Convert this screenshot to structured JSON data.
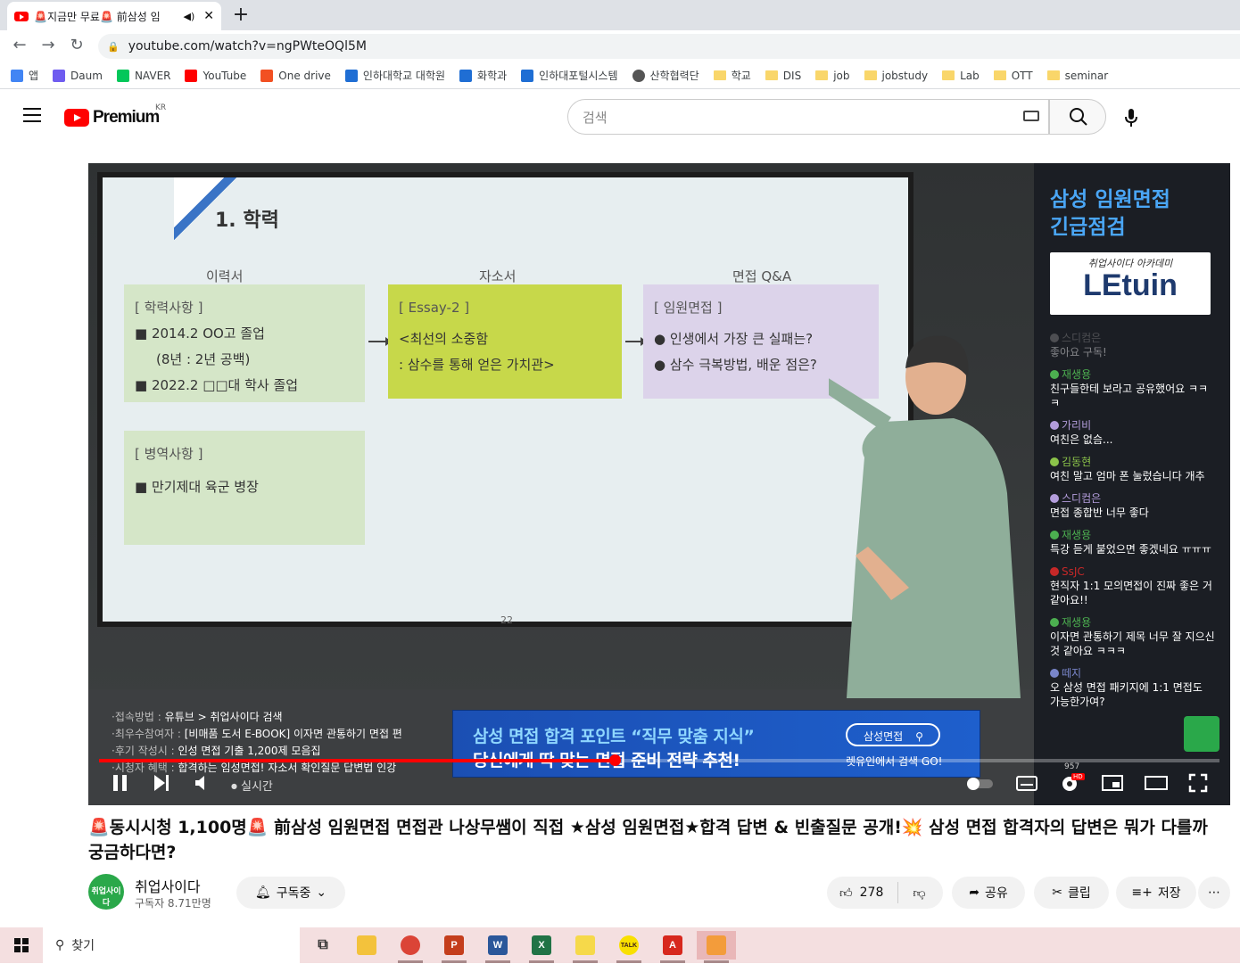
{
  "browser": {
    "tab_title": "🚨지금만 무료🚨 前삼성 임",
    "url": "youtube.com/watch?v=ngPWteOQl5M",
    "bookmarks": [
      {
        "label": "앱",
        "icon": "apps-icon"
      },
      {
        "label": "Daum",
        "icon": "daum-icon"
      },
      {
        "label": "NAVER",
        "icon": "naver-icon"
      },
      {
        "label": "YouTube",
        "icon": "youtube-icon"
      },
      {
        "label": "One drive",
        "icon": "onedrive-icon"
      },
      {
        "label": "인하대학교 대학원",
        "icon": "inha-icon"
      },
      {
        "label": "화학과",
        "icon": "inha-icon"
      },
      {
        "label": "인하대포털시스템",
        "icon": "inha-icon"
      },
      {
        "label": "산학협력단",
        "icon": "globe-icon"
      },
      {
        "label": "학교",
        "icon": "folder-icon"
      },
      {
        "label": "DIS",
        "icon": "folder-icon"
      },
      {
        "label": "job",
        "icon": "folder-icon"
      },
      {
        "label": "jobstudy",
        "icon": "folder-icon"
      },
      {
        "label": "Lab",
        "icon": "folder-icon"
      },
      {
        "label": "OTT",
        "icon": "folder-icon"
      },
      {
        "label": "seminar",
        "icon": "folder-icon"
      }
    ]
  },
  "youtube": {
    "logo_text": "Premium",
    "region": "KR",
    "search_placeholder": "검색"
  },
  "slide": {
    "title": "1. 학력",
    "col_1": "이력서",
    "col_2": "자소서",
    "col_3": "면접 Q&A",
    "card1_head": "[ 학력사항 ]",
    "card1_l1": "■ 2014.2 OO고 졸업",
    "card1_l2": "(8년 : 2년 공백)",
    "card1_l3": "■ 2022.2 □□대 학사 졸업",
    "card2_head": "[ Essay-2 ]",
    "card2_l1": "<최선의 소중함",
    "card2_l2": ": 삼수를 통해 얻은 가치관>",
    "card3_head": "[ 임원면접 ]",
    "card3_l1": "● 인생에서 가장 큰 실패는?",
    "card3_l2": "● 삼수 극복방법, 배운 점은?",
    "card4_head": "[ 병역사항 ]",
    "card4_l1": "■ 만기제대 육군 병장",
    "page": "22"
  },
  "ad_panel": {
    "title_1": "삼성 임원면접",
    "title_2": "긴급점검",
    "logo_small": "취업사이다 아카데미",
    "logo_big": "LEtuin"
  },
  "chat": [
    {
      "name": "스디컴은",
      "text": "좋아요 구독!",
      "color": "#8a8a8a",
      "faded": true
    },
    {
      "name": "재생용",
      "text": "친구들한테 보라고 공유했어요 ㅋㅋㅋ",
      "color": "#4caf50",
      "faded": false
    },
    {
      "name": "가리비",
      "text": "여친은 없슴...",
      "color": "#b39ddb",
      "faded": false
    },
    {
      "name": "김동현",
      "text": "여친 말고 엄마 폰 눌렀습니다 개추",
      "color": "#8bc34a",
      "faded": false
    },
    {
      "name": "스디컴은",
      "text": "면접 종합반 너무 좋다",
      "color": "#b39ddb",
      "faded": false
    },
    {
      "name": "재생용",
      "text": "특강 듣게 붙었으면 좋겠네요 ㅠㅠㅠ",
      "color": "#4caf50",
      "faded": false
    },
    {
      "name": "SsJC",
      "text": "현직자 1:1 모의면접이 진짜 좋은 거 같아요!!",
      "color": "#c62828",
      "faded": false
    },
    {
      "name": "재생용",
      "text": "이자면 관통하기 제목 너무 잘 지으신 것 같아요 ㅋㅋㅋ",
      "color": "#4caf50",
      "faded": false
    },
    {
      "name": "떼지",
      "text": "오 삼성 면접 패키지에 1:1 면접도 가능한가여?",
      "color": "#7986cb",
      "faded": false
    }
  ],
  "chat_count": "957",
  "overlay": {
    "line1_key": "·접속방법 : ",
    "line1_val": "유튜브 > 취업사이다 검색",
    "line2_key": "·최우수참여자 : ",
    "line2_val": "[비매품 도서 E-BOOK] 이자면 관통하기 면접 편",
    "line3_key": "·후기 작성시 : ",
    "line3_val": "인성 면접 기출 1,200제 모음집",
    "line4_key": "·시청자 혜택 : ",
    "line4_val": "합격하는 임성면접! 자소서 확인질문 답변법 인강"
  },
  "banner": {
    "line1": "삼성 면접 합격 포인트 “직무 맞춤 지식”",
    "line2": "당신에게 딱 맞는 면접 준비 전략 추천!",
    "pill": "삼성면접",
    "sub": "렛유인에서 검색 GO!"
  },
  "player": {
    "live_label": "실시간",
    "progress": 0.46,
    "badge_hd": "HD"
  },
  "video": {
    "title": "🚨동시시청 1,100명🚨 前삼성 임원면접 면접관 나상무쌤이 직접 ★삼성 임원면접★합격 답변 & 빈출질문 공개!💥 삼성 면접 합격자의 답변은 뭐가 다를까 궁금하다면?",
    "channel": "취업사이다",
    "channel_avatar_text": "취업사이다",
    "subscribers": "구독자 8.71만명",
    "subscribe_label": "구독중",
    "likes": "278",
    "share_label": "공유",
    "clip_label": "클립",
    "save_label": "저장"
  },
  "taskbar": {
    "search_label": "찾기",
    "apps": [
      {
        "name": "taskview-icon",
        "label": "⧉",
        "color": "#333333"
      },
      {
        "name": "file-explorer-icon",
        "label": "",
        "color": "#f3c23c"
      },
      {
        "name": "chrome-icon",
        "label": "",
        "color": "#db4437"
      },
      {
        "name": "powerpoint-icon",
        "label": "P",
        "color": "#c43e1c"
      },
      {
        "name": "word-icon",
        "label": "W",
        "color": "#2b579a"
      },
      {
        "name": "excel-icon",
        "label": "X",
        "color": "#217346"
      },
      {
        "name": "sticky-notes-icon",
        "label": "",
        "color": "#f6d94a"
      },
      {
        "name": "kakaotalk-icon",
        "label": "TALK",
        "color": "#f9e000"
      },
      {
        "name": "acrobat-icon",
        "label": "A",
        "color": "#d7281e"
      },
      {
        "name": "paint-icon",
        "label": "",
        "color": "#f39c3b"
      }
    ]
  }
}
